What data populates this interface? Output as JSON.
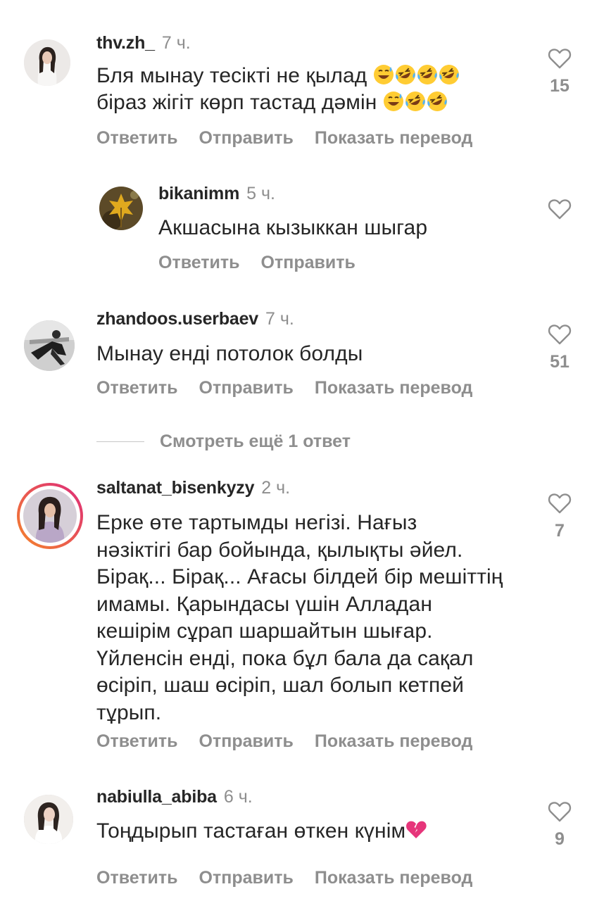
{
  "actions": {
    "reply": "Ответить",
    "send": "Отправить",
    "translate": "Показать перевод"
  },
  "comments": [
    {
      "username": "thv.zh_",
      "time": "7 ч.",
      "line1": "Бля мынау тесікті не қылад",
      "line1_emojis": [
        "grinning-sweat-emoji",
        "rolling-laughing-emoji",
        "rolling-laughing-emoji",
        "rolling-laughing-emoji"
      ],
      "line2": "біраз жігіт көрп тастад дәмін",
      "line2_emojis": [
        "grinning-sweat-emoji",
        "rolling-laughing-emoji",
        "rolling-laughing-emoji"
      ],
      "likes": "15"
    },
    {
      "username": "bikanimm",
      "time": "5 ч.",
      "text": "Акшасына кызыккан шыгар"
    },
    {
      "username": "zhandoos.userbaev",
      "time": "7 ч.",
      "text": "Мынау енді потолок болды",
      "likes": "51"
    },
    {
      "username": "saltanat_bisenkyzy",
      "time": "2 ч.",
      "lines": [
        "Ерке өте тартымды негізі. Нағыз",
        "нәзіктігі бар бойында, қылықты әйел.",
        "Бірақ... Бірақ... Ағасы білдей бір мешіттің",
        "имамы. Қарындасы үшін Алладан",
        "кешірім сұрап шаршайтын шығар.",
        "Үйленсін енді, пока бұл бала да сақал",
        "өсіріп, шаш өсіріп, шал болып кетпей",
        "тұрып."
      ],
      "likes": "7"
    },
    {
      "username": "nabiulla_abiba",
      "time": "6 ч.",
      "text": "Тоңдырып тастаған өткен күнім",
      "emoji": "broken-heart-emoji",
      "likes": "9"
    }
  ],
  "more_replies": "Смотреть ещё 1 ответ",
  "colors": {
    "text": "#262626",
    "secondary": "#8e8e8e",
    "story_ring_start": "#f58529",
    "story_ring_end": "#dd2a7b",
    "heart_broken": "#e6357a"
  }
}
